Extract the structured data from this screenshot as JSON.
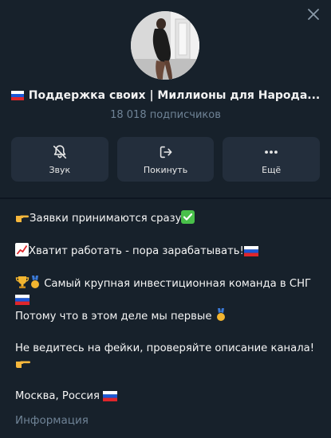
{
  "channel": {
    "title": "Поддержка своих | Миллионы для Народа...",
    "subscribers": "18 018 подписчиков"
  },
  "actions": [
    {
      "label": "Звук",
      "icon": "bell-muted-icon"
    },
    {
      "label": "Покинуть",
      "icon": "leave-icon"
    },
    {
      "label": "Ещё",
      "icon": "more-dots-icon"
    }
  ],
  "description": {
    "line1": "Заявки принимаются сразу",
    "line2": "Хватит работать - пора зарабатывать!",
    "line3": "Самый крупная инвестиционная команда в СНГ",
    "line4": "Потому что в этом деле мы первые",
    "line5": "Не ведитесь на фейки, проверяйте описание канала!",
    "line6": "Москва, Россия"
  },
  "info_label": "Информация",
  "colors": {
    "background": "#17212b",
    "button_bg": "#232e3c",
    "muted_text": "#6f8396"
  }
}
